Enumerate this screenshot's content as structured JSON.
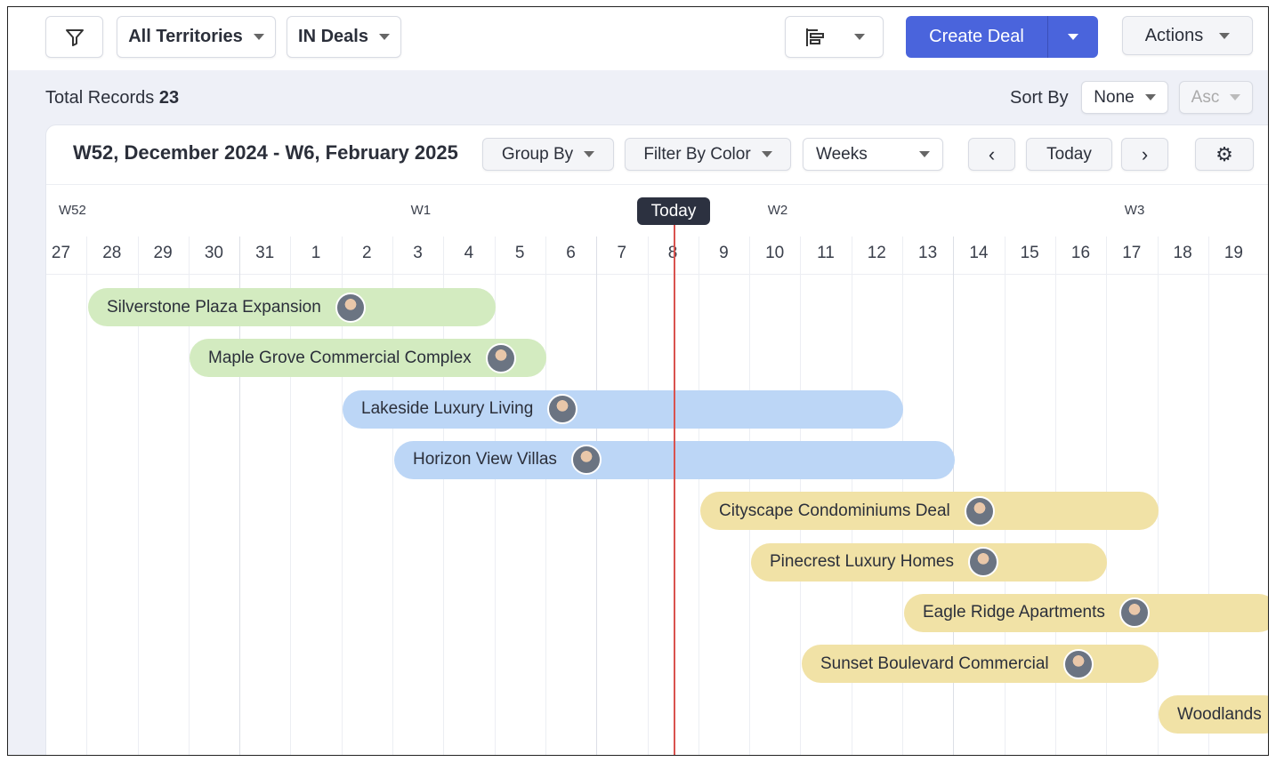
{
  "toolbar": {
    "territory": "All Territories",
    "module": "IN Deals",
    "create": "Create Deal",
    "actions": "Actions"
  },
  "records": {
    "label": "Total Records",
    "count": "23"
  },
  "sort": {
    "label": "Sort By",
    "value": "None",
    "order": "Asc"
  },
  "calendar": {
    "range": "W52, December 2024 - W6, February 2025",
    "group_by": "Group By",
    "filter_color": "Filter By Color",
    "view": "Weeks",
    "today": "Today",
    "today_marker": "Today"
  },
  "weeks": [
    "W52",
    "W1",
    "W2",
    "W3"
  ],
  "days": [
    "27",
    "28",
    "29",
    "30",
    "31",
    "1",
    "2",
    "3",
    "4",
    "5",
    "6",
    "7",
    "8",
    "9",
    "10",
    "11",
    "12",
    "13",
    "14",
    "15",
    "16",
    "17",
    "18",
    "19"
  ],
  "colors": {
    "green": "#d3ebc0",
    "blue": "#bcd6f6",
    "yellow": "#f1e2a6",
    "accent": "#4a64dc",
    "today_line": "#d9534f"
  },
  "deals": [
    {
      "name": "Silverstone Plaza Expansion",
      "color": "green"
    },
    {
      "name": "Maple Grove Commercial Complex",
      "color": "green"
    },
    {
      "name": "Lakeside Luxury Living",
      "color": "blue"
    },
    {
      "name": "Horizon View Villas",
      "color": "blue"
    },
    {
      "name": "Cityscape Condominiums Deal",
      "color": "yellow"
    },
    {
      "name": "Pinecrest Luxury Homes",
      "color": "yellow"
    },
    {
      "name": "Eagle Ridge Apartments",
      "color": "yellow"
    },
    {
      "name": "Sunset Boulevard Commercial",
      "color": "yellow"
    },
    {
      "name": "Woodlands",
      "color": "yellow"
    }
  ]
}
